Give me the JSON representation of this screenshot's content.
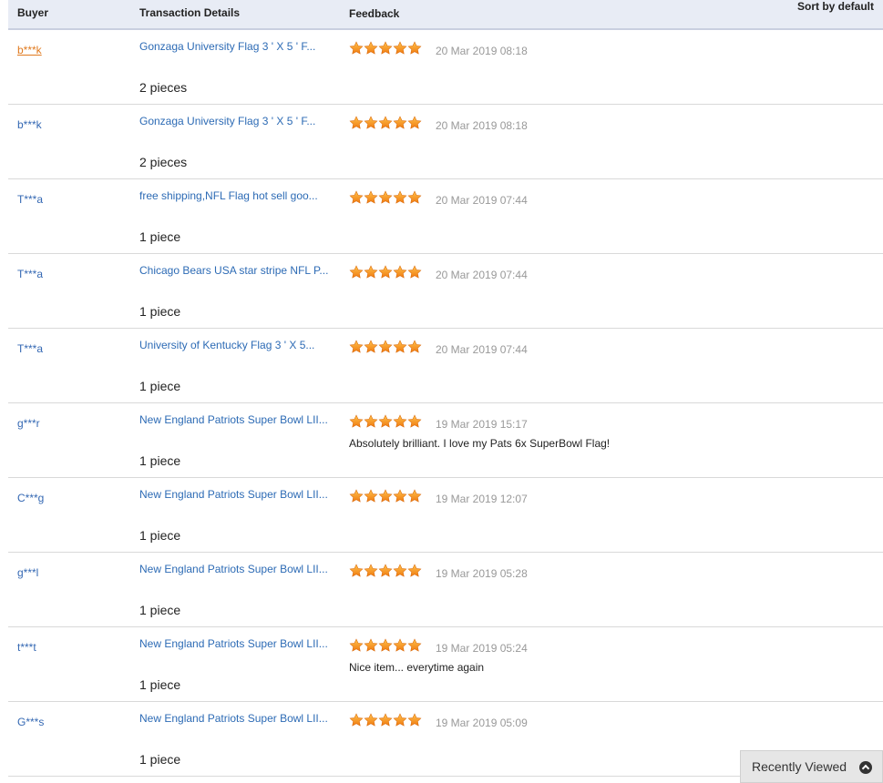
{
  "header": {
    "buyer": "Buyer",
    "transaction": "Transaction Details",
    "feedback": "Feedback",
    "sort": "Sort by default"
  },
  "rows": [
    {
      "buyer": "b***k",
      "item": "Gonzaga University Flag 3 ' X 5 ' F...",
      "qty": "2 pieces",
      "rating": 5,
      "date": "20 Mar 2019 08:18",
      "comment": ""
    },
    {
      "buyer": "b***k",
      "item": "Gonzaga University Flag 3 ' X 5 ' F...",
      "qty": "2 pieces",
      "rating": 5,
      "date": "20 Mar 2019 08:18",
      "comment": ""
    },
    {
      "buyer": "T***a",
      "item": "free shipping,NFL Flag hot sell goo...",
      "qty": "1 piece",
      "rating": 5,
      "date": "20 Mar 2019 07:44",
      "comment": ""
    },
    {
      "buyer": "T***a",
      "item": "Chicago Bears USA star stripe NFL P...",
      "qty": "1 piece",
      "rating": 5,
      "date": "20 Mar 2019 07:44",
      "comment": ""
    },
    {
      "buyer": "T***a",
      "item": "University of Kentucky Flag 3 ' X 5...",
      "qty": "1 piece",
      "rating": 5,
      "date": "20 Mar 2019 07:44",
      "comment": ""
    },
    {
      "buyer": "g***r",
      "item": "New England Patriots Super Bowl LII...",
      "qty": "1 piece",
      "rating": 5,
      "date": "19 Mar 2019 15:17",
      "comment": "Absolutely brilliant. I love my Pats 6x SuperBowl Flag!"
    },
    {
      "buyer": "C***g",
      "item": "New England Patriots Super Bowl LII...",
      "qty": "1 piece",
      "rating": 5,
      "date": "19 Mar 2019 12:07",
      "comment": ""
    },
    {
      "buyer": "g***l",
      "item": "New England Patriots Super Bowl LII...",
      "qty": "1 piece",
      "rating": 5,
      "date": "19 Mar 2019 05:28",
      "comment": ""
    },
    {
      "buyer": "t***t",
      "item": "New England Patriots Super Bowl LII...",
      "qty": "1 piece",
      "rating": 5,
      "date": "19 Mar 2019 05:24",
      "comment": "Nice item... everytime again"
    },
    {
      "buyer": "G***s",
      "item": "New England Patriots Super Bowl LII...",
      "qty": "1 piece",
      "rating": 5,
      "date": "19 Mar 2019 05:09",
      "comment": ""
    }
  ],
  "recently_viewed": {
    "label": "Recently Viewed",
    "icon": "chevron-up-circle-icon"
  },
  "colors": {
    "star": "#f7941d",
    "link": "#2d6bb5",
    "active_link": "#e07a1f",
    "header_bg": "#e8ecf5"
  }
}
